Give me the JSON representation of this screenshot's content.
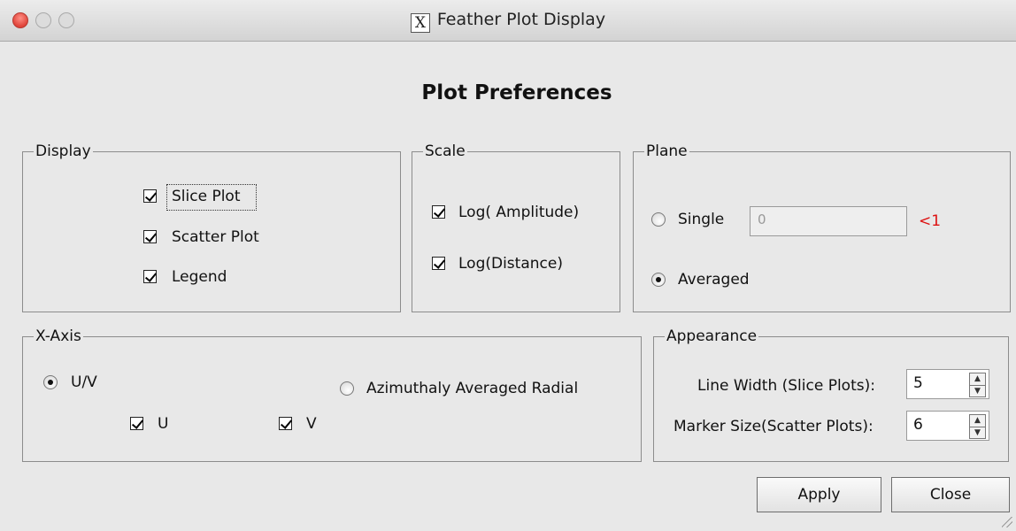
{
  "window": {
    "title": "Feather Plot Display",
    "x_logo": "X"
  },
  "heading": "Plot Preferences",
  "display": {
    "legend": "Display",
    "items": [
      {
        "label": "Slice Plot",
        "checked": true
      },
      {
        "label": "Scatter Plot",
        "checked": true
      },
      {
        "label": "Legend",
        "checked": true
      }
    ]
  },
  "scale": {
    "legend": "Scale",
    "items": [
      {
        "label": "Log( Amplitude)",
        "checked": true
      },
      {
        "label": "Log(Distance)",
        "checked": true
      }
    ]
  },
  "plane": {
    "legend": "Plane",
    "single_label": "Single",
    "single_value": "0",
    "hint": "<1",
    "averaged_label": "Averaged",
    "selected": "Averaged",
    "hint_color": "#dd1111"
  },
  "xaxis": {
    "legend": "X-Axis",
    "uv_label": "U/V",
    "radial_label": "Azimuthaly Averaged Radial",
    "selected": "U/V",
    "u_label": "U",
    "v_label": "V",
    "u_checked": true,
    "v_checked": true
  },
  "appearance": {
    "legend": "Appearance",
    "line_width_label": "Line Width (Slice Plots):",
    "line_width_value": "5",
    "marker_size_label": "Marker Size(Scatter Plots):",
    "marker_size_value": "6"
  },
  "buttons": {
    "apply": "Apply",
    "close": "Close"
  }
}
